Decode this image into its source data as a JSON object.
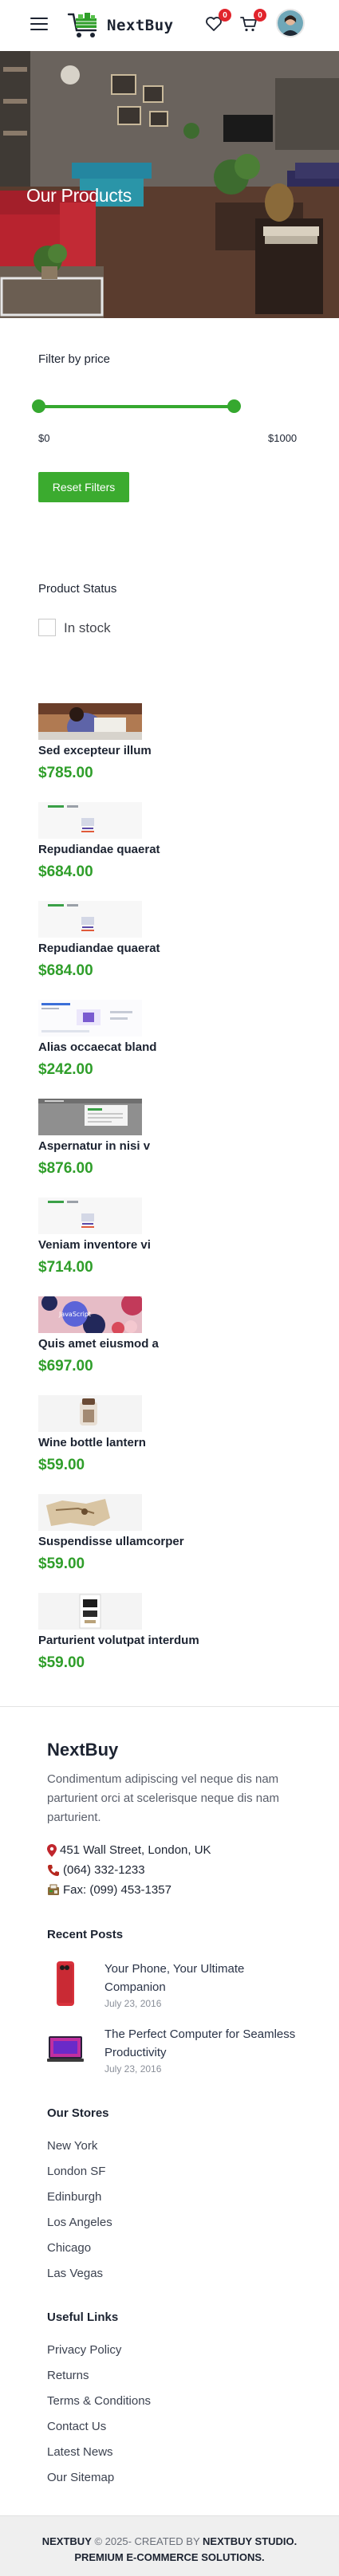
{
  "header": {
    "brand": "NextBuy",
    "wishlist_count": "0",
    "cart_count": "0",
    "icons": [
      "hamburger-icon",
      "logo-cart-icon",
      "heart-icon",
      "cart-icon",
      "avatar"
    ]
  },
  "hero": {
    "title": "Our Products"
  },
  "filters": {
    "price_title": "Filter by price",
    "price_min": "$0",
    "price_max": "$1000",
    "reset_label": "Reset Filters",
    "status_title": "Product Status",
    "in_stock_label": "In stock",
    "accent_color": "#35a82f"
  },
  "products": [
    {
      "name": "Sed excepteur illum",
      "price": "$785.00"
    },
    {
      "name": "Repudiandae quaerat",
      "price": "$684.00"
    },
    {
      "name": "Repudiandae quaerat",
      "price": "$684.00"
    },
    {
      "name": "Alias occaecat bland",
      "price": "$242.00"
    },
    {
      "name": "Aspernatur in nisi v",
      "price": "$876.00"
    },
    {
      "name": "Veniam inventore vi",
      "price": "$714.00"
    },
    {
      "name": "Quis amet eiusmod a",
      "price": "$697.00"
    },
    {
      "name": "Wine bottle lantern",
      "price": "$59.00"
    },
    {
      "name": "Suspendisse ullamcorper",
      "price": "$59.00"
    },
    {
      "name": "Parturient volutpat interdum",
      "price": "$59.00"
    }
  ],
  "footer": {
    "brand": "NextBuy",
    "description": "Condimentum adipiscing vel neque dis nam parturient orci at scelerisque neque dis nam parturient.",
    "address": "451 Wall Street, London, UK",
    "phone": "(064) 332-1233",
    "fax": "Fax: (099) 453-1357",
    "recent_posts_title": "Recent Posts",
    "posts": [
      {
        "title": "Your Phone, Your Ultimate Companion",
        "date": "July 23, 2016"
      },
      {
        "title": "The Perfect Computer for Seamless Productivity",
        "date": "July 23, 2016"
      }
    ],
    "stores_title": "Our Stores",
    "stores": [
      "New York",
      "London SF",
      "Edinburgh",
      "Los Angeles",
      "Chicago",
      "Las Vegas"
    ],
    "links_title": "Useful Links",
    "links": [
      "Privacy Policy",
      "Returns",
      "Terms & Conditions",
      "Contact Us",
      "Latest News",
      "Our Sitemap"
    ],
    "copyright_brand": "NEXTBUY",
    "copyright_mid": " © 2025- CREATED BY ",
    "copyright_studio": "NEXTBUY STUDIO.",
    "copyright_line2": "PREMIUM E-COMMERCE SOLUTIONS."
  }
}
